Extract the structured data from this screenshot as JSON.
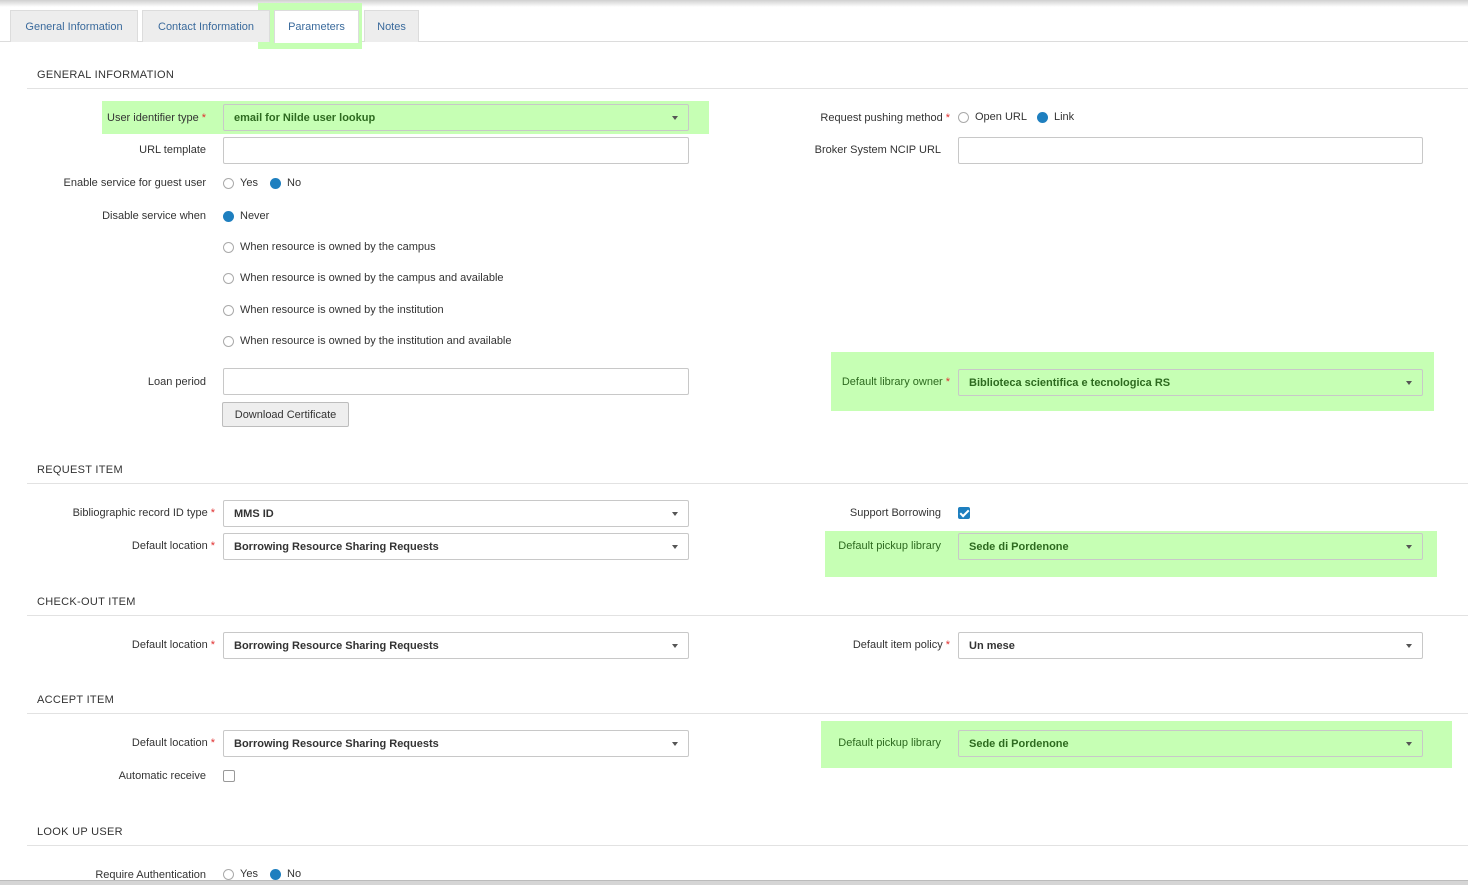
{
  "tabs": [
    "General Information",
    "Contact Information",
    "Parameters",
    "Notes"
  ],
  "general": {
    "section": "GENERAL INFORMATION",
    "user_identifier_type": {
      "label": "User identifier type",
      "value": "email for Nilde user lookup"
    },
    "url_template": {
      "label": "URL template",
      "value": ""
    },
    "guest": {
      "label": "Enable service for guest user",
      "yes": "Yes",
      "no": "No"
    },
    "disable": {
      "label": "Disable service when",
      "options": [
        "Never",
        "When resource is owned by the campus",
        "When resource is owned by the campus and available",
        "When resource is owned by the institution",
        "When resource is owned by the institution and available"
      ]
    },
    "loan_period": {
      "label": "Loan period",
      "value": ""
    },
    "download_button": "Download Certificate",
    "request_pushing": {
      "label": "Request pushing method",
      "open_url": "Open URL",
      "link": "Link"
    },
    "broker_ncip": {
      "label": "Broker System NCIP URL",
      "value": ""
    },
    "default_library_owner": {
      "label": "Default library owner",
      "value": "Biblioteca scientifica e tecnologica RS"
    }
  },
  "request_item": {
    "section": "REQUEST ITEM",
    "bib_id_type": {
      "label": "Bibliographic record ID type",
      "value": "MMS ID"
    },
    "default_location": {
      "label": "Default location",
      "value": "Borrowing Resource Sharing Requests"
    },
    "support_borrowing": {
      "label": "Support Borrowing"
    },
    "default_pickup": {
      "label": "Default pickup library",
      "value": "Sede di Pordenone"
    }
  },
  "checkout_item": {
    "section": "CHECK-OUT ITEM",
    "default_location": {
      "label": "Default location",
      "value": "Borrowing Resource Sharing Requests"
    },
    "default_item_policy": {
      "label": "Default item policy",
      "value": "Un mese"
    }
  },
  "accept_item": {
    "section": "ACCEPT ITEM",
    "default_location": {
      "label": "Default location",
      "value": "Borrowing Resource Sharing Requests"
    },
    "automatic_receive": {
      "label": "Automatic receive"
    },
    "default_pickup": {
      "label": "Default pickup library",
      "value": "Sede di Pordenone"
    }
  },
  "lookup_user": {
    "section": "LOOK UP USER",
    "require_auth": {
      "label": "Require Authentication",
      "yes": "Yes",
      "no": "No"
    }
  },
  "colors": {
    "highlight": "#c6ffb4",
    "accent": "#1e7fbf",
    "link": "#3a6a9c",
    "required": "#e03030"
  }
}
